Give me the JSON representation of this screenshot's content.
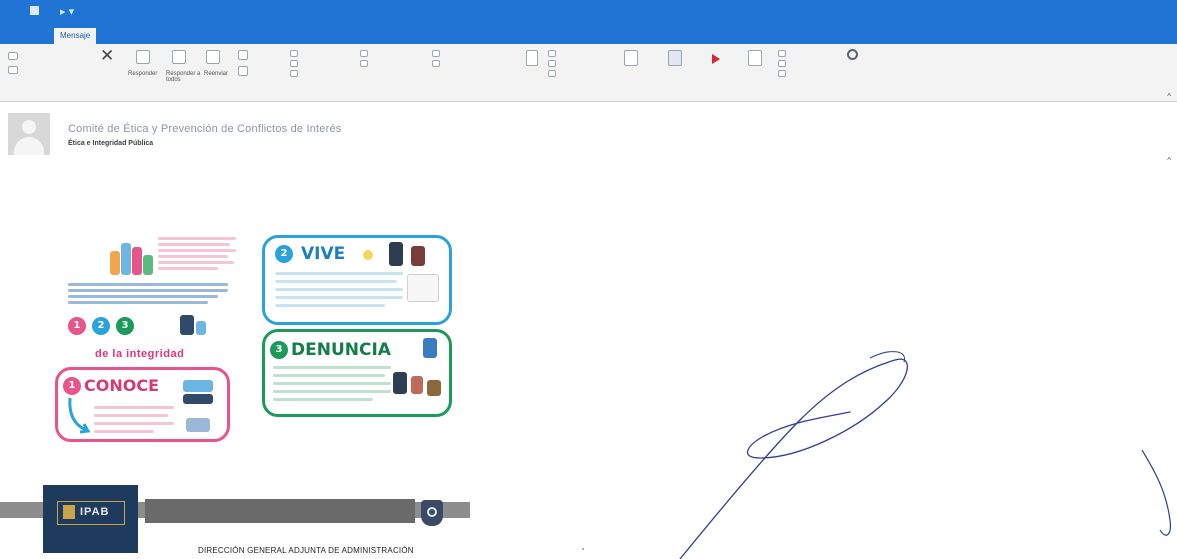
{
  "ribbon": {
    "active_tab": "Mensaje",
    "commands": {
      "forward": "Reenviar",
      "reply": "Responder",
      "reply_all": "Responder a todos",
      "search": "Buscar"
    }
  },
  "message": {
    "subject": "Comité de Ética y Prevención de Conflictos de Interés",
    "sender": "Ética e Integridad Pública"
  },
  "poster": {
    "vive_title": "VIVE",
    "denuncia_title": "DENUNCIA",
    "conoce_title": "CONOCE",
    "integrity_label": "de la integridad",
    "badge_1": "1",
    "badge_2": "2",
    "badge_3": "3"
  },
  "banner": {
    "logo_text": "IPAB",
    "department": "DIRECCIÓN GENERAL ADJUNTA DE ADMINISTRACIÓN"
  },
  "colors": {
    "title_bar": "#1f74d4",
    "vive": "#2aa3dc",
    "denuncia": "#1b9a5a",
    "conoce": "#e8558a",
    "integrity_pink": "#e0337a"
  }
}
